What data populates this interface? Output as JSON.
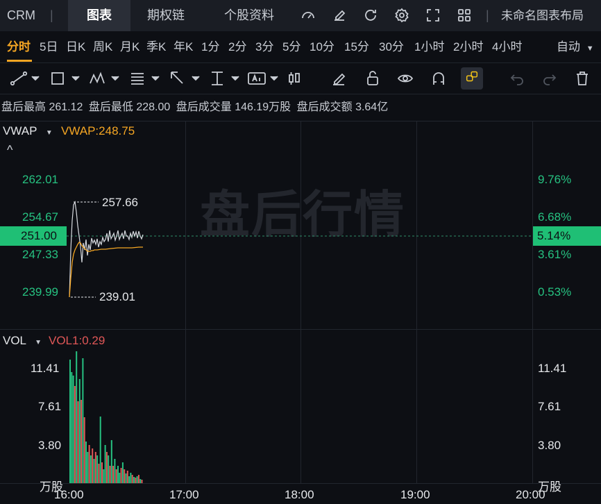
{
  "header": {
    "ticker": "CRM",
    "tabs": [
      "图表",
      "期权链",
      "个股资料"
    ],
    "active_tab": "图表",
    "layout_name": "未命名图表布局"
  },
  "periods": {
    "items": [
      "分时",
      "5日",
      "日K",
      "周K",
      "月K",
      "季K",
      "年K",
      "1分",
      "2分",
      "3分",
      "5分",
      "10分",
      "15分",
      "30分",
      "1小时",
      "2小时",
      "4小时"
    ],
    "active": "分时",
    "auto_label": "自动"
  },
  "stats": {
    "high_label": "盘后最高",
    "high": "261.12",
    "low_label": "盘后最低",
    "low": "228.00",
    "volume_label": "盘后成交量",
    "volume": "146.19万股",
    "turnover_label": "盘后成交额",
    "turnover": "3.64亿"
  },
  "main_chart": {
    "indicator": "VWAP",
    "indicator_value": "VWAP:248.75",
    "watermark": "盘后行情",
    "left_ticks": [
      "262.01",
      "254.67",
      "247.33",
      "239.99"
    ],
    "right_ticks": [
      "9.76%",
      "6.68%",
      "3.61%",
      "0.53%"
    ],
    "current_price": "251.00",
    "current_pct": "5.14%",
    "high_marker": "257.66",
    "low_marker": "239.01"
  },
  "volume_chart": {
    "indicator": "VOL",
    "indicator_value": "VOL1:0.29",
    "left_ticks": [
      "11.41",
      "7.61",
      "3.80"
    ],
    "right_ticks": [
      "11.41",
      "7.61",
      "3.80"
    ],
    "unit": "万股"
  },
  "x_axis": [
    "16:00",
    "17:00",
    "18:00",
    "19:00",
    "20:00"
  ],
  "colors": {
    "up": "#26c281",
    "down": "#e05757",
    "vwap": "#f5a623",
    "price": "#d8dbe0",
    "accent": "#f5a623"
  }
}
